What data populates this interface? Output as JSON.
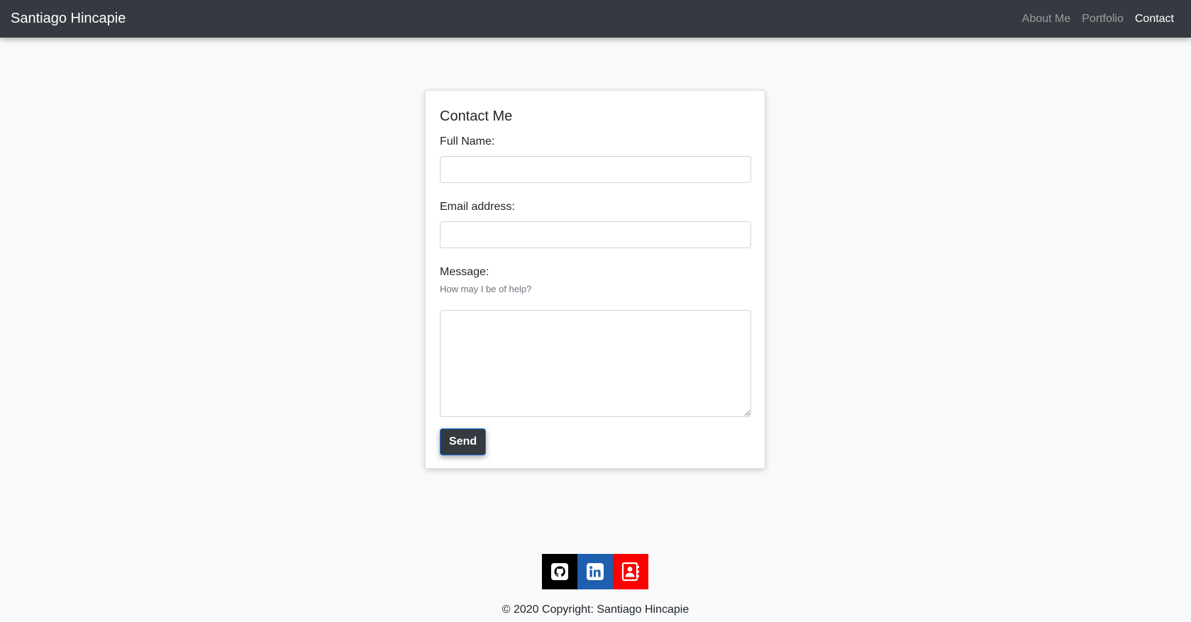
{
  "navbar": {
    "brand": "Santiago Hincapie",
    "links": [
      {
        "label": "About Me",
        "active": false
      },
      {
        "label": "Portfolio",
        "active": false
      },
      {
        "label": "Contact",
        "active": true
      }
    ]
  },
  "form": {
    "title": "Contact Me",
    "name_label": "Full Name:",
    "name_value": "",
    "email_label": "Email address:",
    "email_value": "",
    "message_label": "Message:",
    "message_help": "How may I be of help?",
    "message_value": "",
    "send_label": "Send"
  },
  "footer": {
    "icons": [
      {
        "name": "github-icon",
        "color": "#000000"
      },
      {
        "name": "linkedin-icon",
        "color": "#1f5fb0"
      },
      {
        "name": "contact-book-icon",
        "color": "#ff0000"
      }
    ],
    "copyright": "© 2020 Copyright: Santiago Hincapie"
  },
  "colors": {
    "navbar_bg": "#343a40",
    "page_bg": "#f8f9fa",
    "button_bg": "#343a40"
  }
}
